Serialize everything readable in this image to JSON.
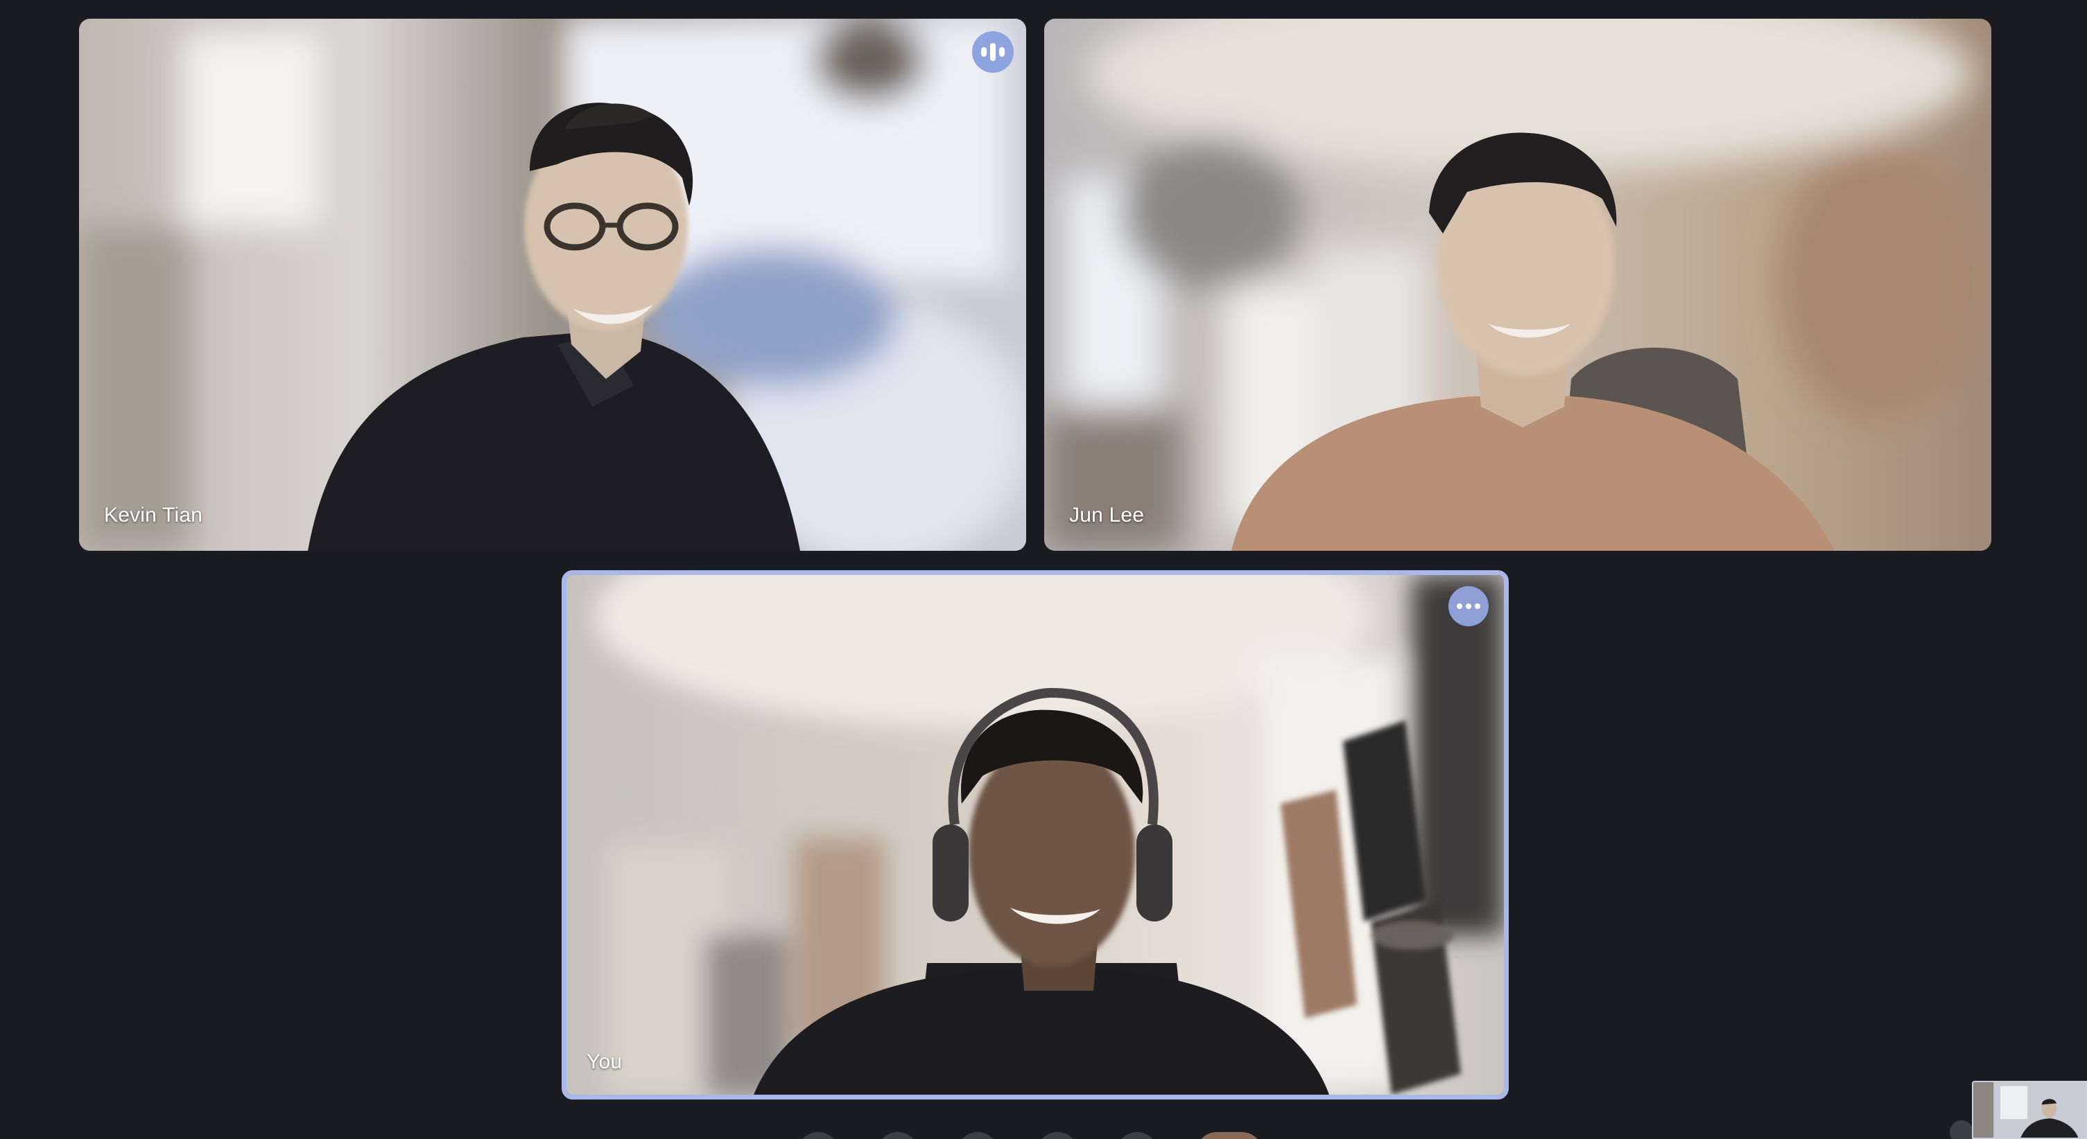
{
  "participants": {
    "kevin": {
      "name": "Kevin Tian",
      "speaking_icon": "audio-waveform-icon"
    },
    "jun": {
      "name": "Jun Lee"
    },
    "you": {
      "name": "You",
      "more_icon": "more-options-icon"
    }
  },
  "colors": {
    "background": "#1b1c22",
    "active_border": "#a9b8e8",
    "indicator": "#8fa3e0"
  },
  "controls": {
    "buttons": [
      "mic-button",
      "camera-button",
      "captions-button",
      "raise-hand-button",
      "more-options-button",
      "end-call-button"
    ]
  }
}
